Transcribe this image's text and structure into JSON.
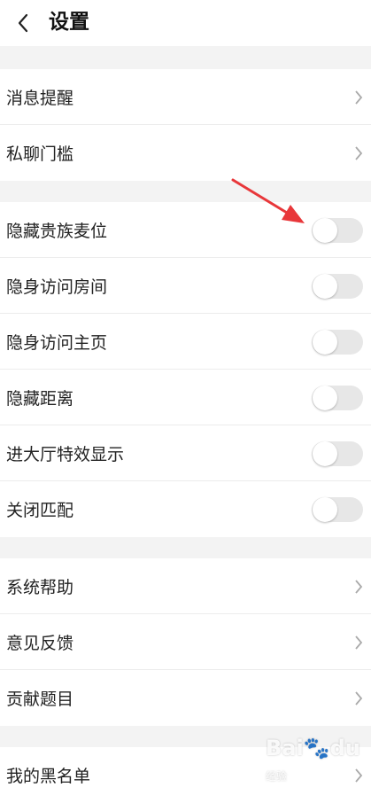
{
  "header": {
    "title": "设置"
  },
  "groups": [
    {
      "items": [
        {
          "label": "消息提醒",
          "type": "link"
        },
        {
          "label": "私聊门槛",
          "type": "link"
        }
      ]
    },
    {
      "items": [
        {
          "label": "隐藏贵族麦位",
          "type": "toggle",
          "on": false
        },
        {
          "label": "隐身访问房间",
          "type": "toggle",
          "on": false
        },
        {
          "label": "隐身访问主页",
          "type": "toggle",
          "on": false
        },
        {
          "label": "隐藏距离",
          "type": "toggle",
          "on": false
        },
        {
          "label": "进大厅特效显示",
          "type": "toggle",
          "on": false
        },
        {
          "label": "关闭匹配",
          "type": "toggle",
          "on": false
        }
      ]
    },
    {
      "items": [
        {
          "label": "系统帮助",
          "type": "link"
        },
        {
          "label": "意见反馈",
          "type": "link"
        },
        {
          "label": "贡献题目",
          "type": "link"
        }
      ]
    },
    {
      "items": [
        {
          "label": "我的黑名单",
          "type": "link"
        }
      ]
    }
  ],
  "watermark": {
    "brand": "Bai",
    "suffix": "du",
    "sub": "经验"
  },
  "colors": {
    "annotation_arrow": "#e8373a",
    "toggle_off": "#e7e7e7"
  }
}
